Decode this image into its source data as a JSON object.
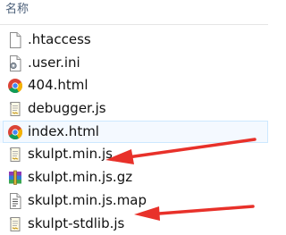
{
  "header": {
    "column_label": "名称"
  },
  "files": [
    {
      "name": ".htaccess",
      "icon": "generic-file-icon"
    },
    {
      "name": ".user.ini",
      "icon": "settings-file-icon"
    },
    {
      "name": "404.html",
      "icon": "chrome-html-icon"
    },
    {
      "name": "debugger.js",
      "icon": "script-file-icon"
    },
    {
      "name": "index.html",
      "icon": "chrome-html-icon",
      "selected": true
    },
    {
      "name": "skulpt.min.js",
      "icon": "script-file-icon"
    },
    {
      "name": "skulpt.min.js.gz",
      "icon": "winrar-archive-icon"
    },
    {
      "name": "skulpt.min.js.map",
      "icon": "text-file-icon"
    },
    {
      "name": "skulpt-stdlib.js",
      "icon": "script-file-icon"
    }
  ],
  "colors": {
    "header_text": "#4c607a",
    "selection_border": "#cde8ff",
    "annotation_arrow": "#e8312a"
  }
}
